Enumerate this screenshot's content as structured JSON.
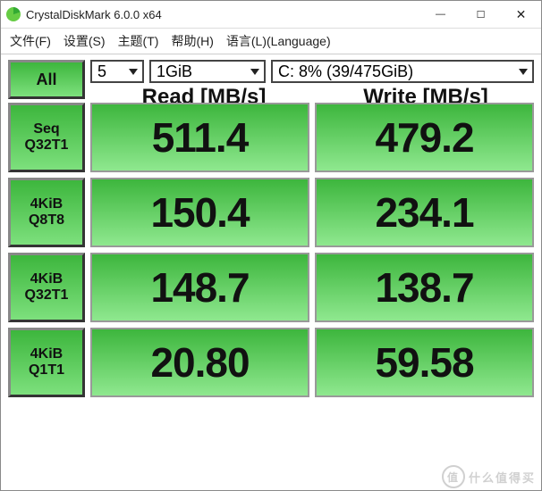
{
  "window": {
    "title": "CrystalDiskMark 6.0.0 x64"
  },
  "menu": {
    "file": "文件(F)",
    "settings": "设置(S)",
    "theme": "主题(T)",
    "help": "帮助(H)",
    "language": "语言(L)(Language)"
  },
  "controls": {
    "all_label": "All",
    "count": "5",
    "size": "1GiB",
    "drive": "C: 8% (39/475GiB)"
  },
  "columns": {
    "read": "Read [MB/s]",
    "write": "Write [MB/s]"
  },
  "rows": [
    {
      "l1": "Seq",
      "l2": "Q32T1",
      "read": "511.4",
      "write": "479.2"
    },
    {
      "l1": "4KiB",
      "l2": "Q8T8",
      "read": "150.4",
      "write": "234.1"
    },
    {
      "l1": "4KiB",
      "l2": "Q32T1",
      "read": "148.7",
      "write": "138.7"
    },
    {
      "l1": "4KiB",
      "l2": "Q1T1",
      "read": "20.80",
      "write": "59.58"
    }
  ],
  "watermark": {
    "logo": "值",
    "text": "什么值得买"
  },
  "chart_data": {
    "type": "table",
    "title": "CrystalDiskMark 6.0.0 x64",
    "columns": [
      "Test",
      "Read [MB/s]",
      "Write [MB/s]"
    ],
    "rows": [
      [
        "Seq Q32T1",
        511.4,
        479.2
      ],
      [
        "4KiB Q8T8",
        150.4,
        234.1
      ],
      [
        "4KiB Q32T1",
        148.7,
        138.7
      ],
      [
        "4KiB Q1T1",
        20.8,
        59.58
      ]
    ],
    "drive": "C: 8% (39/475GiB)",
    "test_count": 5,
    "test_size": "1GiB"
  }
}
